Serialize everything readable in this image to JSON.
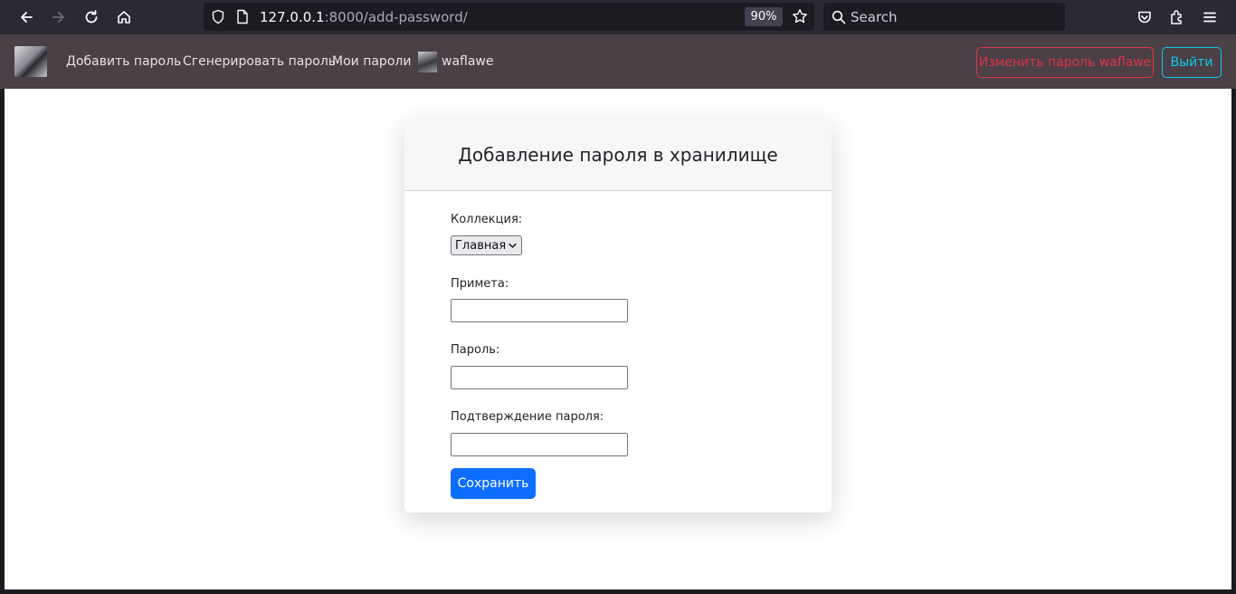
{
  "browser": {
    "url_host": "127.0.0.1",
    "url_path": ":8000/add-password/",
    "zoom": "90%",
    "search_placeholder": "Search"
  },
  "navbar": {
    "links": [
      "Добавить пароль",
      "Сгенерировать пароль",
      "Мои пароли"
    ],
    "username": "waflawe",
    "change_password_label": "Изменить пароль waflawe",
    "logout_label": "Выйти"
  },
  "form": {
    "title": "Добавление пароля в хранилище",
    "collection_label": "Коллекция:",
    "collection_value": "Главная",
    "note_label": "Примета:",
    "password_label": "Пароль:",
    "confirm_label": "Подтверждение пароля:",
    "submit_label": "Сохранить"
  },
  "colors": {
    "primary": "#0d6efd",
    "danger": "#dc3545",
    "info": "#0dcaf0",
    "navbar_bg": "#4b4045"
  }
}
